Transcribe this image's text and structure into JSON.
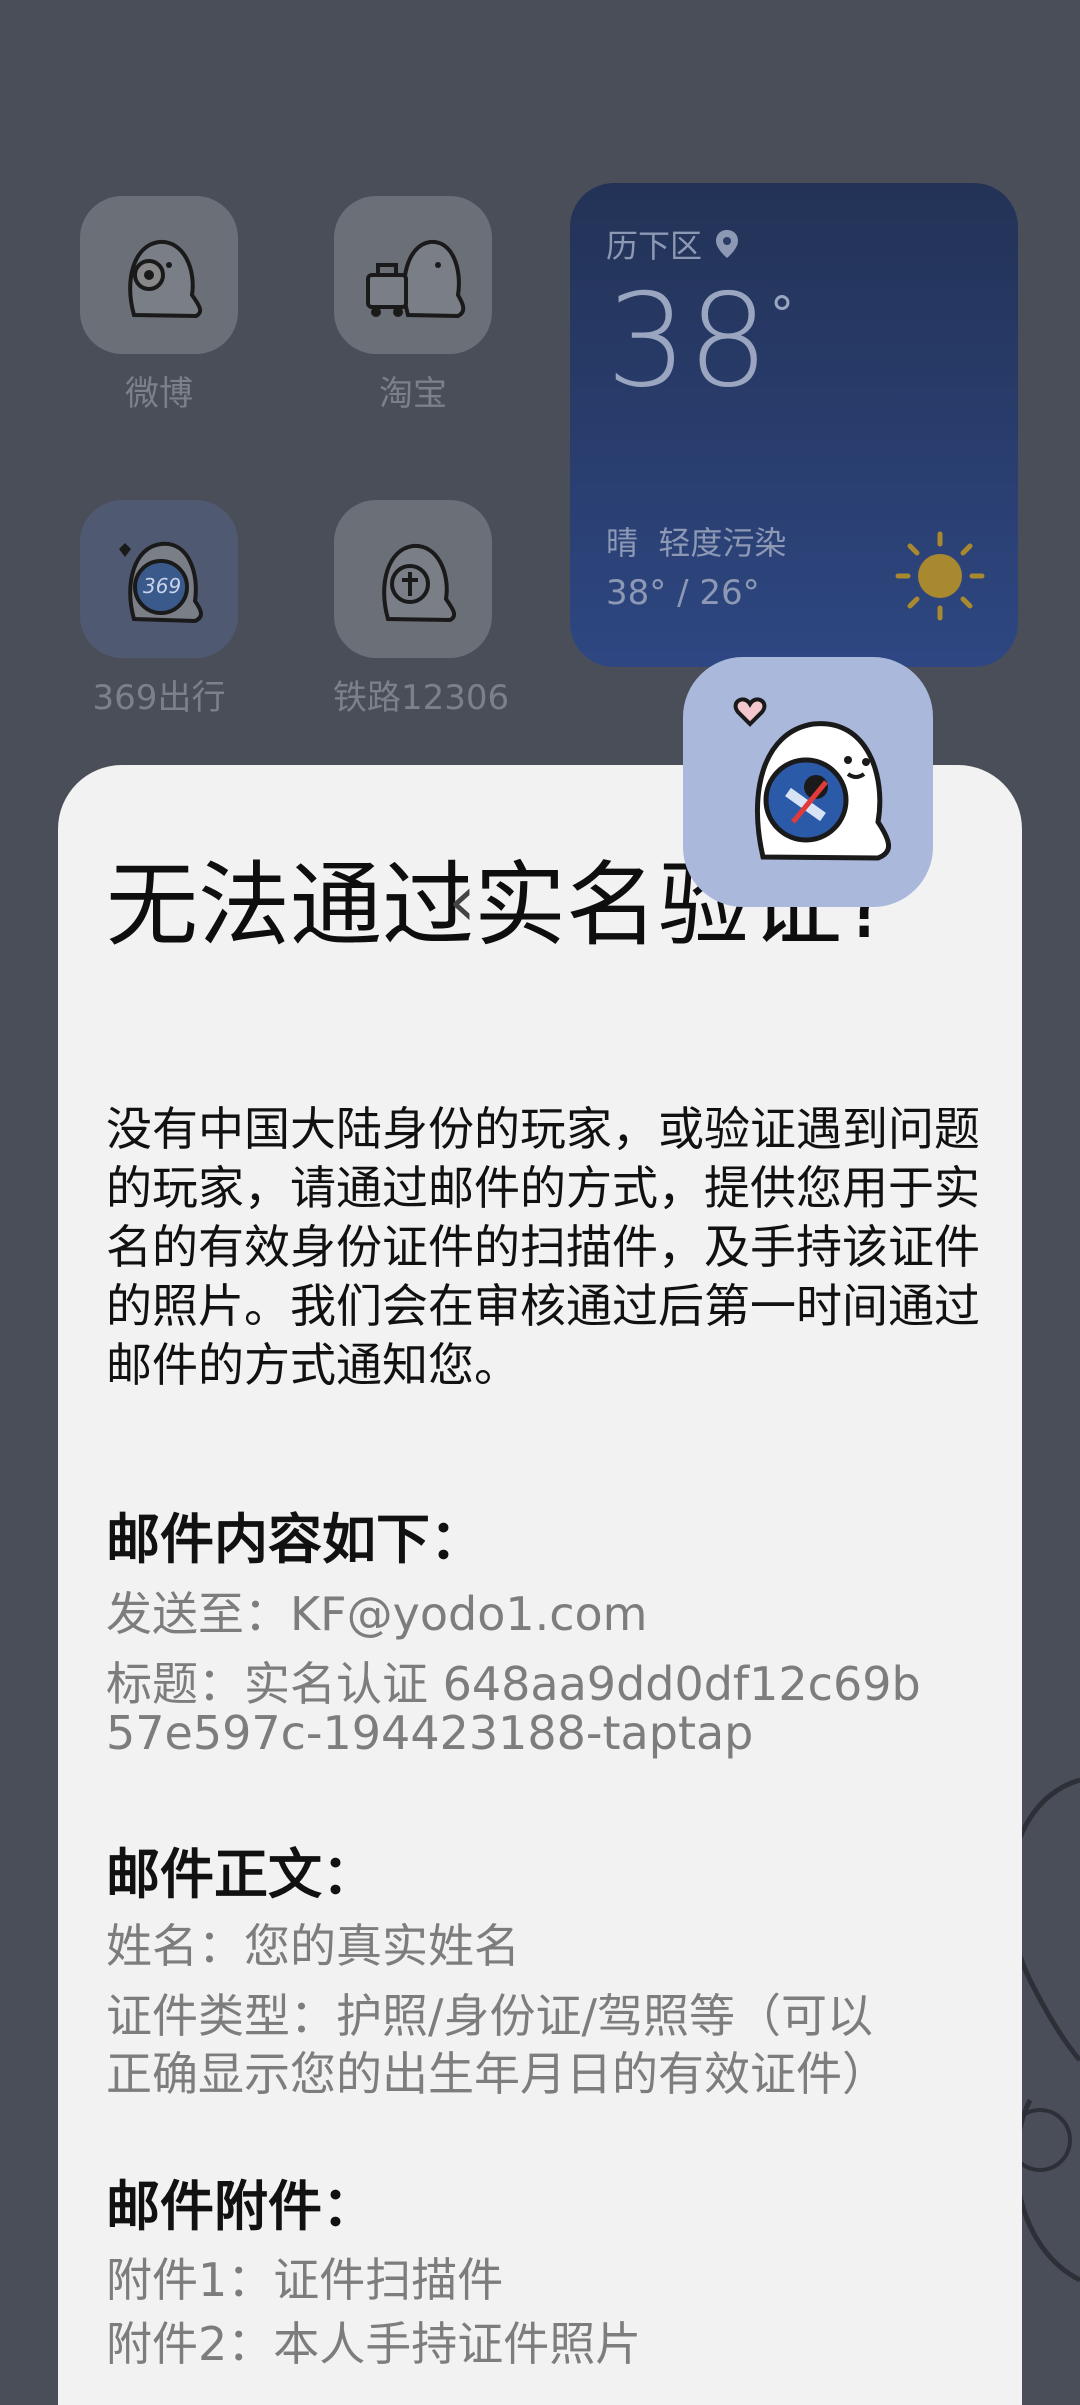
{
  "apps": [
    {
      "label": "微博",
      "icon": "weibo-app-icon"
    },
    {
      "label": "淘宝",
      "icon": "taobao-app-icon"
    },
    {
      "label": "369出行",
      "icon": "369-travel-app-icon"
    },
    {
      "label": "铁路12306",
      "icon": "railway-12306-app-icon"
    }
  ],
  "weather": {
    "location": "历下区",
    "temperature": "38",
    "degree": "°",
    "condition": "晴",
    "air_quality": "轻度污染",
    "range": "38° / 26°"
  },
  "dialog": {
    "title": "无法通过实名验证?",
    "intro": "没有中国大陆身份的玩家，或验证遇到问题的玩家，请通过邮件的方式，提供您用于实名的有效身份证件的扫描件，及手持该证件的照片。我们会在审核通过后第一时间通过邮件的方式通知您。",
    "mail_header": "邮件内容如下：",
    "send_to": "发送至：KF@yodo1.com",
    "subject_line1": "标题：实名认证 648aa9dd0df12c69b",
    "subject_line2": "57e597c-194423188-taptap",
    "body_header": "邮件正文：",
    "name_line": "姓名：您的真实姓名",
    "id_type_line1": "证件类型：护照/身份证/驾照等（可以",
    "id_type_line2": "正确显示您的出生年月日的有效证件）",
    "attach_header": "邮件附件：",
    "attach1": "附件1：证件扫描件",
    "attach2": "附件2：本人手持证件照片"
  }
}
